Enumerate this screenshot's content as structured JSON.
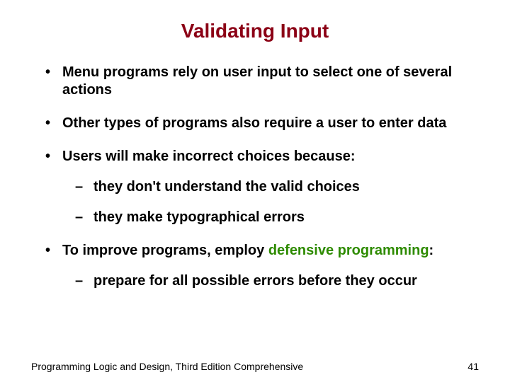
{
  "title": "Validating Input",
  "bullets": {
    "b1": "Menu programs rely on user input to select one of several actions",
    "b2": "Other types of programs also require a user to enter data",
    "b3": "Users will make incorrect choices because:",
    "b3a": "they don't understand the valid choices",
    "b3b": "they make typographical errors",
    "b4_pre": "To improve programs, employ ",
    "b4_green": "defensive programming",
    "b4_post": ":",
    "b4a": "prepare for all possible errors before they occur"
  },
  "footer": {
    "left": "Programming Logic and Design, Third Edition Comprehensive",
    "right": "41"
  }
}
